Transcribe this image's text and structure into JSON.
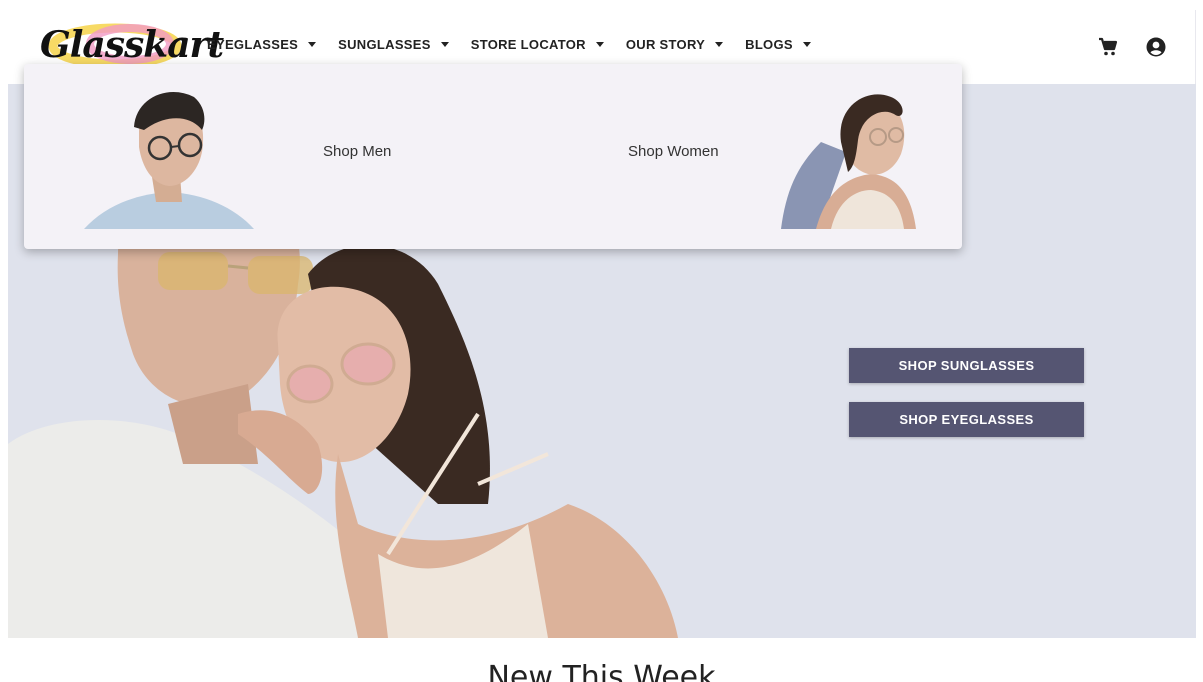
{
  "brand": {
    "logo_text": "Glasskart"
  },
  "nav": {
    "items": [
      {
        "label": "EYEGLASSES"
      },
      {
        "label": "SUNGLASSES"
      },
      {
        "label": "STORE LOCATOR"
      },
      {
        "label": "OUR STORY"
      },
      {
        "label": "BLOGS"
      }
    ]
  },
  "header_icons": [
    "cart-icon",
    "account-icon"
  ],
  "dropdown": {
    "shop_men_label": "Shop Men",
    "shop_women_label": "Shop Women"
  },
  "hero": {
    "shop_sunglasses_label": "SHOP SUNGLASSES",
    "shop_eyeglasses_label": "SHOP EYEGLASSES"
  },
  "section": {
    "title": "New This Week"
  },
  "colors": {
    "hero_bg": "#dfe2ec",
    "button_bg": "#555572",
    "dropdown_bg": "#f4f2f7"
  }
}
